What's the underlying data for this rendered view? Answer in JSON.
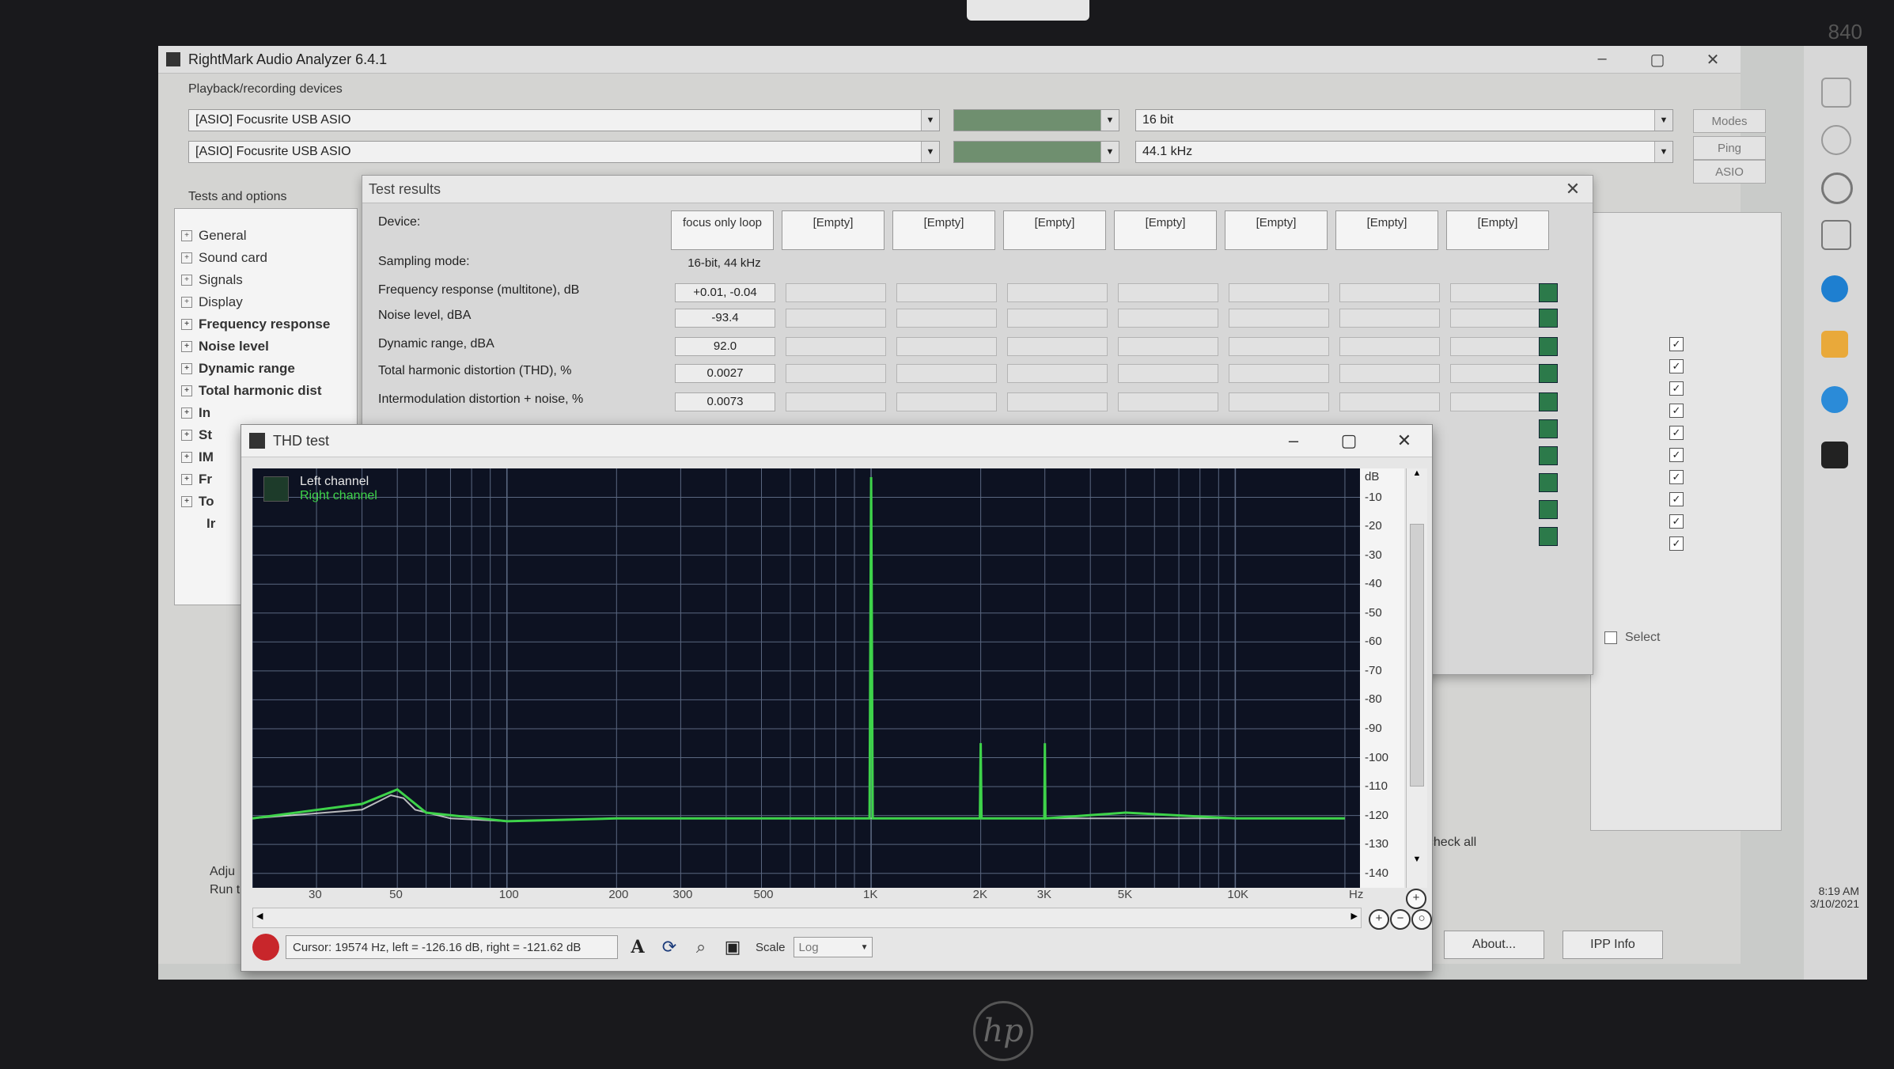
{
  "device": {
    "model": "840"
  },
  "app": {
    "title": "RightMark Audio Analyzer 6.4.1",
    "playback_group": "Playback/recording devices",
    "tests_group": "Tests and options",
    "playback_device": "[ASIO] Focusrite USB ASIO",
    "recording_device": "[ASIO] Focusrite USB ASIO",
    "bit_depth": "16 bit",
    "sample_rate": "44.1 kHz",
    "buttons": {
      "modes": "Modes",
      "ping": "Ping",
      "asio": "ASIO",
      "about": "About...",
      "ipp_info": "IPP Info",
      "uncheck_all": "ncheck all",
      "select": "Select"
    },
    "tree": [
      "General",
      "Sound card",
      "Signals",
      "Display",
      "Frequency response",
      "Noise level",
      "Dynamic range",
      "Total harmonic dist",
      "In",
      "St",
      "IM",
      "Fr",
      "To",
      "Ir"
    ],
    "adjust_label": "Adju",
    "run_label": "Run te",
    "clock": {
      "time": "8:19 AM",
      "date": "3/10/2021"
    }
  },
  "test_results": {
    "title": "Test results",
    "rows": [
      {
        "label": "Device:",
        "value": "focus only loop"
      },
      {
        "label": "Sampling mode:",
        "value": "16-bit, 44 kHz"
      },
      {
        "label": "Frequency response (multitone), dB",
        "value": "+0.01, -0.04"
      },
      {
        "label": "Noise level, dBA",
        "value": "-93.4"
      },
      {
        "label": "Dynamic range, dBA",
        "value": "92.0"
      },
      {
        "label": "Total harmonic distortion (THD), %",
        "value": "0.0027"
      },
      {
        "label": "Intermodulation distortion + noise, %",
        "value": "0.0073"
      }
    ],
    "empty_col": "[Empty]"
  },
  "thd": {
    "title": "THD test",
    "legend_left": "Left channel",
    "legend_right": "Right channel",
    "cursor_text": "Cursor: 19574 Hz, left = -126.16 dB, right = -121.62 dB",
    "scale_label": "Scale",
    "scale_value": "Log",
    "y_unit": "dB",
    "x_unit": "Hz",
    "y_ticks": [
      "-10",
      "-20",
      "-30",
      "-40",
      "-50",
      "-60",
      "-70",
      "-80",
      "-90",
      "-100",
      "-110",
      "-120",
      "-130",
      "-140"
    ],
    "x_ticks": [
      "30",
      "50",
      "100",
      "200",
      "300",
      "500",
      "1K",
      "2K",
      "3K",
      "5K",
      "10K"
    ],
    "colors": {
      "left": "#e6e6e6",
      "right": "#3ed34a",
      "bg": "#0d1222",
      "grid": "#5a6780"
    }
  },
  "chart_data": {
    "type": "line",
    "title": "THD test",
    "xlabel": "Hz",
    "ylabel": "dB",
    "xlim": [
      20,
      22000
    ],
    "ylim": [
      -145,
      0
    ],
    "x_scale": "log",
    "series": [
      {
        "name": "Left channel",
        "x": [
          20,
          40,
          48,
          52,
          56,
          70,
          100,
          200,
          500,
          1000,
          1500,
          2000,
          3000,
          4000,
          5000,
          10000,
          15000,
          20000
        ],
        "y": [
          -121,
          -118,
          -113,
          -114,
          -118,
          -121,
          -122,
          -121,
          -121,
          -121,
          -121,
          -121,
          -121,
          -121,
          -121,
          -121,
          -121,
          -121
        ]
      },
      {
        "name": "Right channel",
        "x": [
          20,
          40,
          50,
          60,
          100,
          200,
          500,
          990,
          1000,
          1010,
          1500,
          1990,
          2000,
          2010,
          2500,
          2990,
          3000,
          3010,
          5000,
          10000,
          20000
        ],
        "y": [
          -121,
          -116,
          -111,
          -119,
          -122,
          -121,
          -121,
          -121,
          -3,
          -121,
          -121,
          -121,
          -95,
          -121,
          -121,
          -121,
          -95,
          -121,
          -119,
          -121,
          -121
        ]
      }
    ]
  }
}
